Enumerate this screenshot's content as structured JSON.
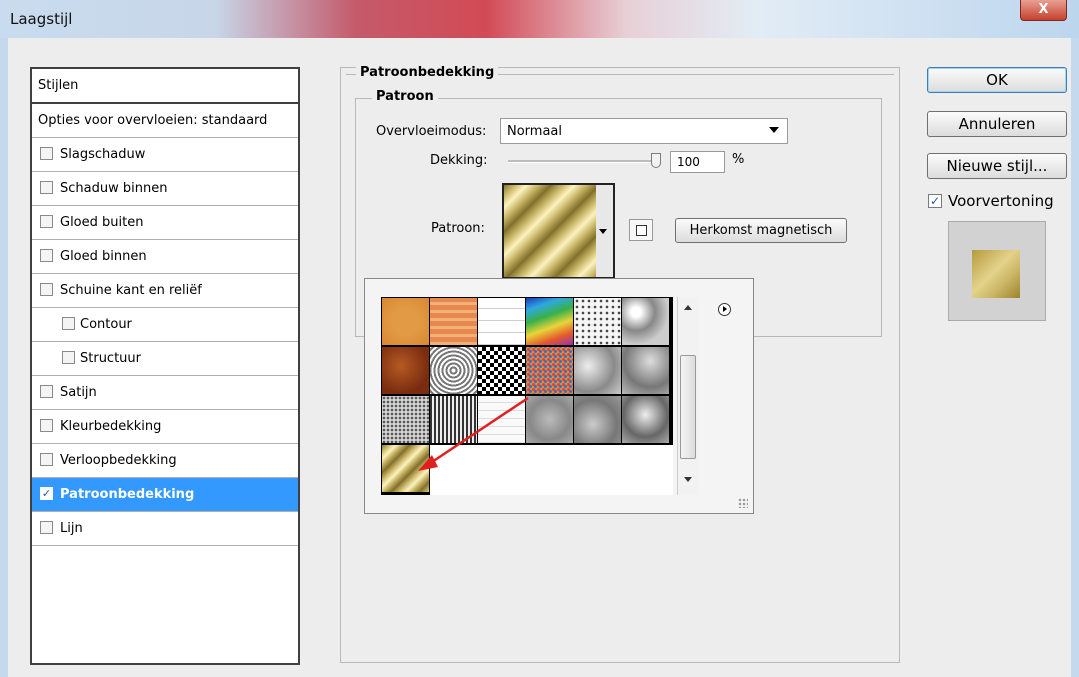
{
  "window": {
    "title": "Laagstijl",
    "close_glyph": "X"
  },
  "styles_panel": {
    "header": "Stijlen",
    "blend_options": "Opties voor overvloeien: standaard",
    "items": [
      {
        "label": "Slagschaduw",
        "checked": false,
        "indent": false
      },
      {
        "label": "Schaduw binnen",
        "checked": false,
        "indent": false
      },
      {
        "label": "Gloed buiten",
        "checked": false,
        "indent": false
      },
      {
        "label": "Gloed binnen",
        "checked": false,
        "indent": false
      },
      {
        "label": "Schuine kant en reliëf",
        "checked": false,
        "indent": false
      },
      {
        "label": "Contour",
        "checked": false,
        "indent": true
      },
      {
        "label": "Structuur",
        "checked": false,
        "indent": true
      },
      {
        "label": "Satijn",
        "checked": false,
        "indent": false
      },
      {
        "label": "Kleurbedekking",
        "checked": false,
        "indent": false
      },
      {
        "label": "Verloopbedekking",
        "checked": false,
        "indent": false
      },
      {
        "label": "Patroonbedekking",
        "checked": true,
        "indent": false,
        "selected": true
      },
      {
        "label": "Lijn",
        "checked": false,
        "indent": false
      }
    ]
  },
  "pattern_overlay": {
    "section_title": "Patroonbedekking",
    "group_title": "Patroon",
    "blend_mode_label": "Overvloeimodus:",
    "blend_mode_value": "Normaal",
    "opacity_label": "Dekking:",
    "opacity_value": "100",
    "opacity_unit": "%",
    "opacity_level": 1.0,
    "pattern_label": "Patroon:",
    "snap_button": "Herkomst magnetisch",
    "check_glyph": "✓",
    "selected_pattern": "gold-diagonal"
  },
  "pattern_picker": {
    "columns": 6,
    "patterns": [
      "orange-solid",
      "orange-grid",
      "white-grid",
      "rainbow-bands",
      "white-speckle",
      "grey-crackle",
      "rust-texture",
      "concentric-squares",
      "checkerboard",
      "multicolor-noise",
      "grey-clouds",
      "grey-stone",
      "grey-noise",
      "dark-stitch",
      "light-brick",
      "grey-blotches",
      "grey-clouds-dark",
      "grey-rock",
      "gold-diagonal"
    ]
  },
  "actions": {
    "ok": "OK",
    "cancel": "Annuleren",
    "new_style": "Nieuwe stijl...",
    "preview_label": "Voorvertoning",
    "preview_checked": true
  },
  "colors": {
    "selection": "#3399ff",
    "annotation_arrow": "#e02020",
    "gold_light": "#fbf2c0",
    "gold_dark": "#7c6b28"
  }
}
